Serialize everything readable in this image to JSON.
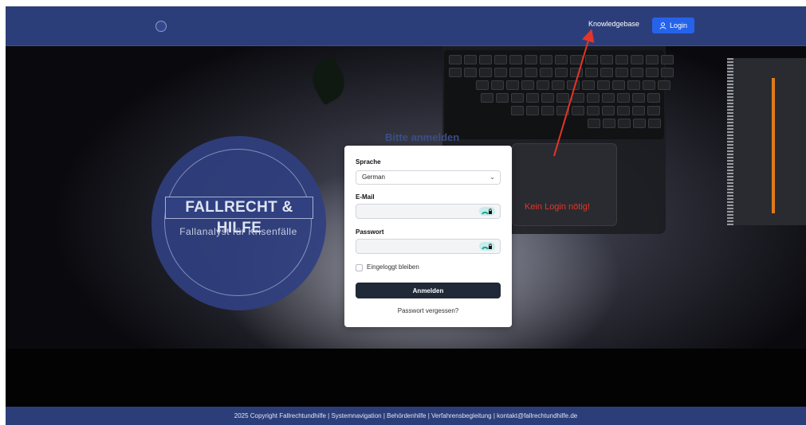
{
  "header": {
    "knowledgebase_label": "Knowledgebase",
    "login_label": "Login"
  },
  "hero": {
    "brand_title": "FALLRECHT & HILFE",
    "brand_subtitle": "Fallanalyst für Krisenfälle",
    "heading_text": "Bitte anmelden"
  },
  "login_form": {
    "language_label": "Sprache",
    "language_value": "German",
    "email_label": "E-Mail",
    "email_value": "",
    "password_label": "Passwort",
    "password_value": "",
    "remember_label": "Eingeloggt bleiben",
    "submit_label": "Anmelden",
    "forgot_label": "Passwort vergessen?"
  },
  "annotation": {
    "text": "Kein Login nötig!",
    "color": "#e53528"
  },
  "footer": {
    "text": "2025 Copyright Fallrechtundhilfe | Systemnavigation | Behördenhilfe | Verfahrensbegleitung | kontakt@fallrechtundhilfe.de"
  },
  "colors": {
    "header_bg": "#2c3e7a",
    "login_button": "#2563eb",
    "submit_button": "#1f2937"
  }
}
